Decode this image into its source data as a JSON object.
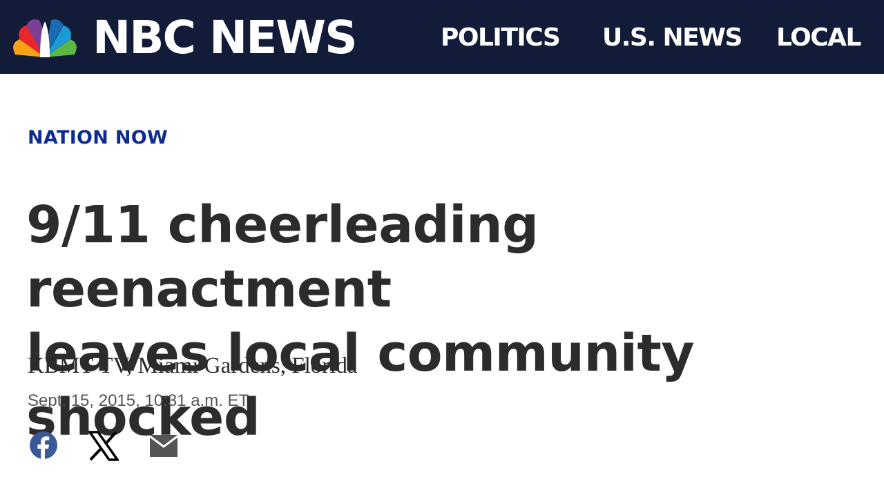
{
  "header": {
    "logo_text": "NBC NEWS",
    "nav": [
      "POLITICS",
      "U.S. NEWS",
      "LOCAL"
    ],
    "background": "#121b37"
  },
  "article": {
    "kicker": "NATION NOW",
    "headline_line1": "9/11 cheerleading reenactment",
    "headline_line2": "leaves local community shocked",
    "source": "KBMT-TV, Miami Gardens, Florida",
    "timestamp": "Sept. 15, 2015, 10:31 a.m. ET"
  },
  "share": {
    "icons": [
      "facebook-icon",
      "x-icon",
      "email-icon"
    ],
    "facebook_color": "#3b5998",
    "x_color": "#000000",
    "email_color": "#555555"
  },
  "colors": {
    "kicker": "#0e2b8f",
    "headline": "#2c2c2c"
  }
}
